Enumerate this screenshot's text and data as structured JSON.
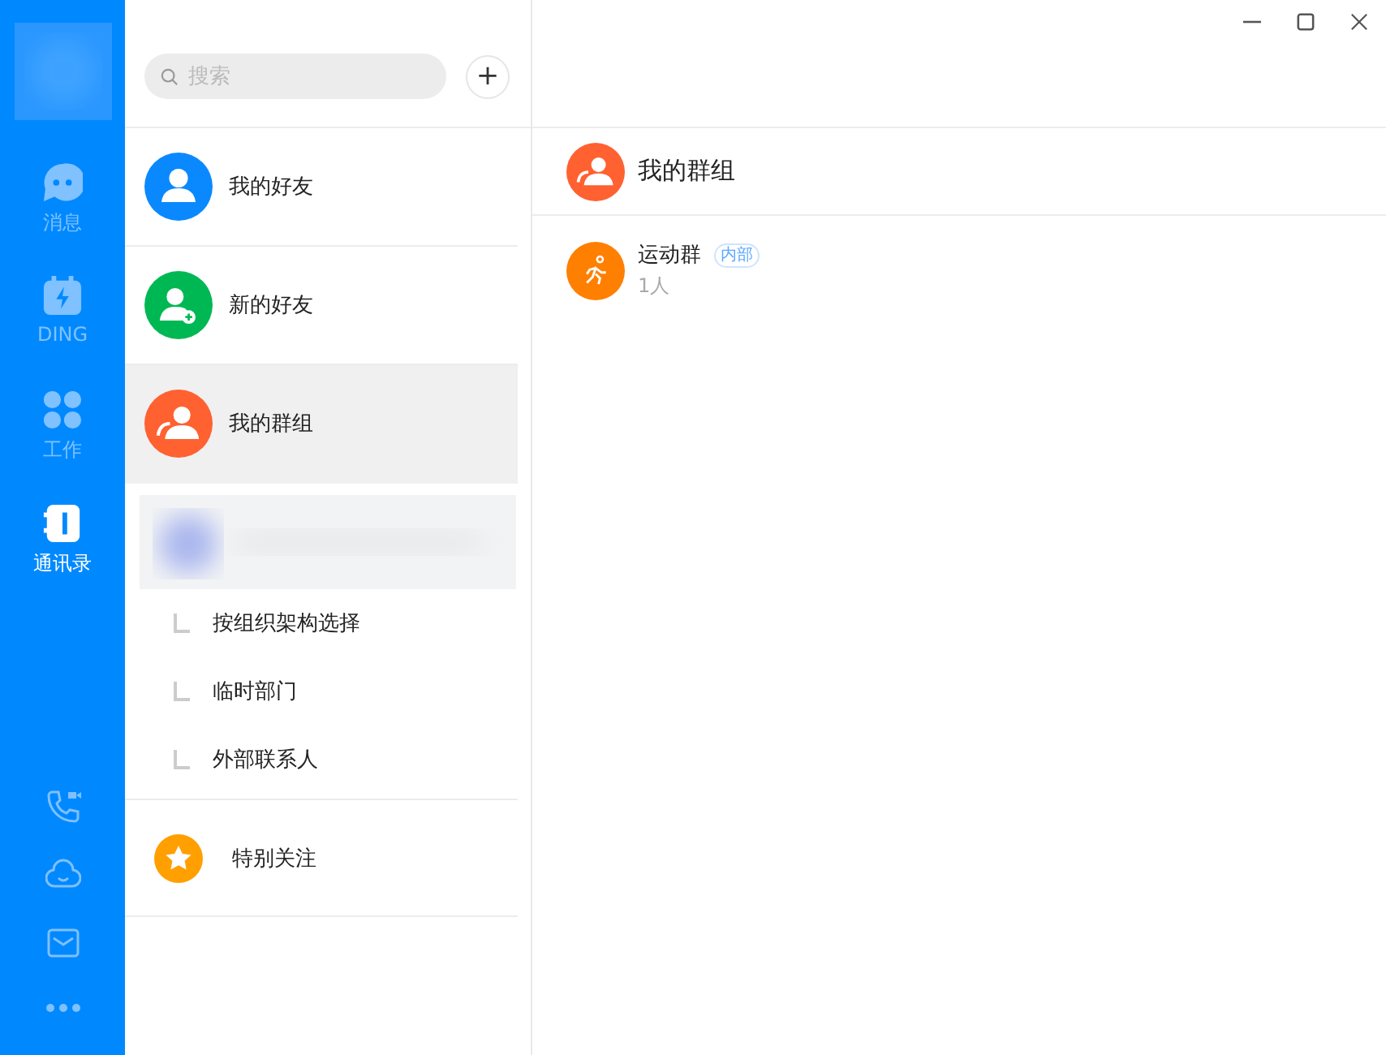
{
  "nav": {
    "items": [
      {
        "label": "消息",
        "selected": false
      },
      {
        "label": "DING",
        "selected": false
      },
      {
        "label": "工作",
        "selected": false
      },
      {
        "label": "通讯录",
        "selected": true
      }
    ]
  },
  "search": {
    "placeholder": "搜索",
    "add": "+"
  },
  "contacts": [
    {
      "kind": "contact",
      "label": "我的好友",
      "color": "#0a89ff",
      "selected": false
    },
    {
      "kind": "contact",
      "label": "新的好友",
      "color": "#00b853",
      "selected": false
    },
    {
      "kind": "contact",
      "label": "我的群组",
      "color": "#ff6130",
      "selected": true
    },
    {
      "kind": "org",
      "children": [
        {
          "label": "按组织架构选择"
        },
        {
          "label": "临时部门"
        },
        {
          "label": "外部联系人"
        }
      ]
    },
    {
      "kind": "starred",
      "label": "特别关注",
      "color": "#ff9f00",
      "selected": false
    }
  ],
  "detail": {
    "title": "我的群组",
    "color": "#ff6130",
    "groups": [
      {
        "name": "运动群",
        "tag": "内部",
        "members": "1人",
        "color": "#ff7f00"
      }
    ]
  }
}
